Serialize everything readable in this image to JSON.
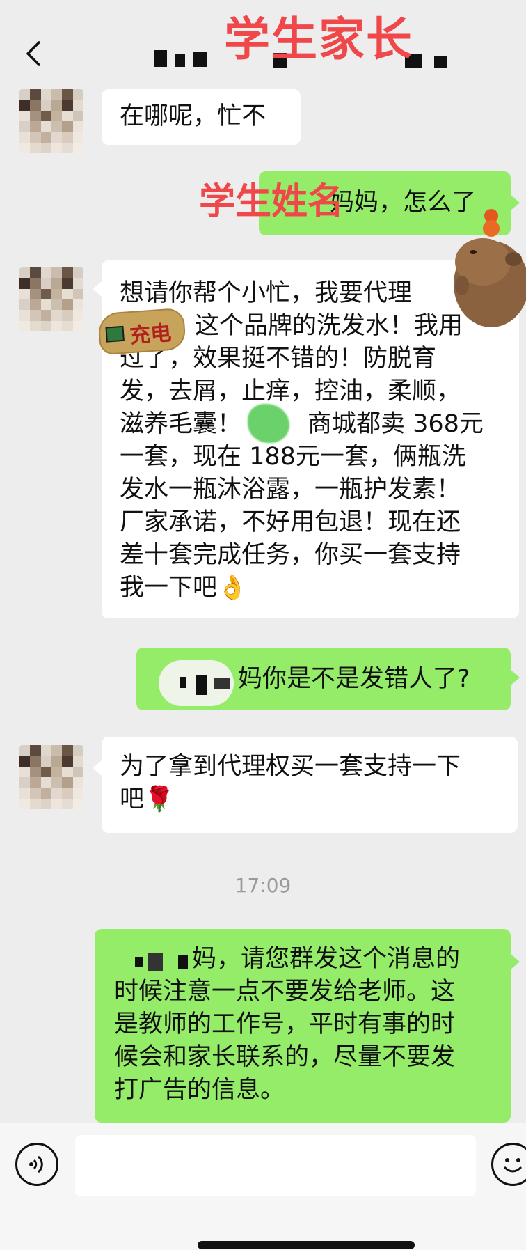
{
  "header": {
    "back_icon": "chevron-left-icon",
    "title_overlay": "学生家长"
  },
  "messages": [
    {
      "side": "left",
      "text": "在哪呢，忙不"
    },
    {
      "side": "right",
      "label_overlay": "学生姓名",
      "text": "妈妈，怎么了"
    },
    {
      "side": "left",
      "lines": [
        "想请你帮个小忙，我要代理",
        "这个品牌的洗发水！我用",
        "过了，效果挺不错的！防脱育",
        "发，去屑，止痒，控油，柔顺，",
        "滋养毛囊！",
        "商城都卖 368元",
        "一套，现在 188元一套，俩瓶洗",
        "发水一瓶沐浴露，一瓶护发素！",
        "厂家承诺，不好用包退！现在还",
        "差十套完成任务，你买一套支持",
        "我一下吧"
      ],
      "sticker_text": "充电"
    },
    {
      "side": "right",
      "text": "妈你是不是发错人了?"
    },
    {
      "side": "left",
      "lines": [
        "为了拿到代理权买一套支持一下",
        "吧"
      ]
    },
    {
      "side": "right",
      "lines": [
        "妈，请您群发这个消息的",
        "时候注意一点不要发给老师。这",
        "是教师的工作号，平时有事的时",
        "候会和家长联系的，尽量不要发",
        "打广告的信息。"
      ]
    }
  ],
  "timestamp": "17:09",
  "icons": {
    "ok_hand": "👌",
    "rose": "🌹"
  },
  "composer": {
    "voice_icon": "voice-icon",
    "emoji_icon": "emoji-icon",
    "input_value": ""
  },
  "colors": {
    "background": "#ededed",
    "bubble_self": "#95ec69",
    "bubble_other": "#ffffff",
    "overlay_red": "#f0484a"
  }
}
